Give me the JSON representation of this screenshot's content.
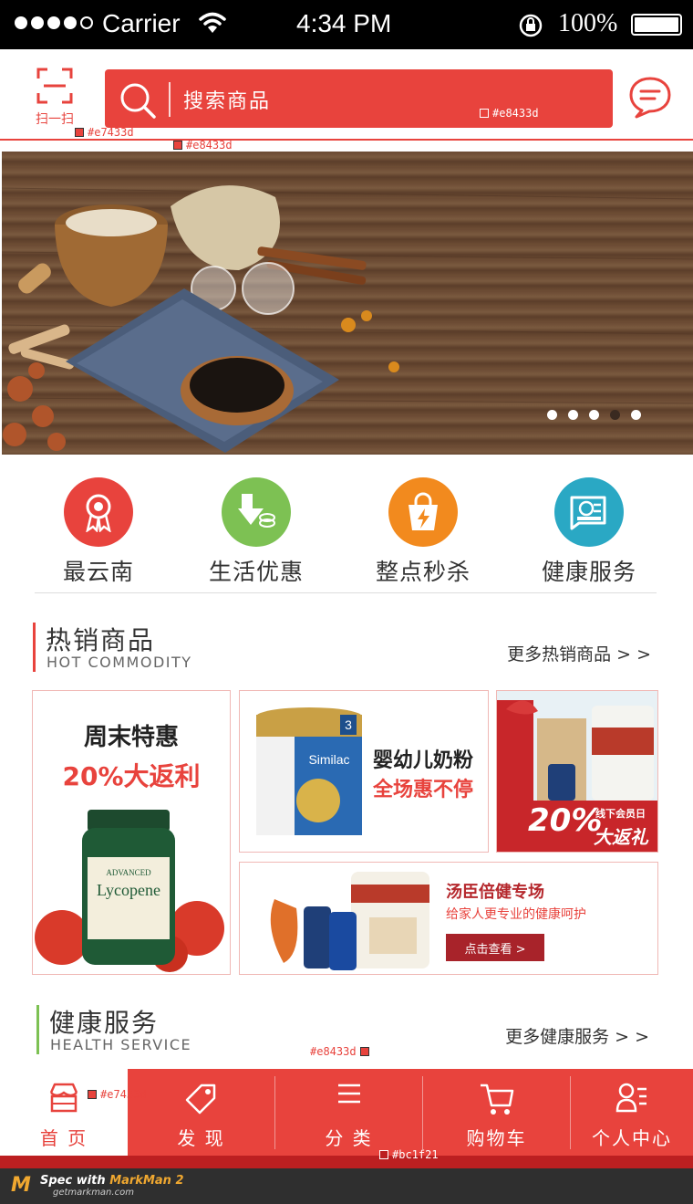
{
  "status_bar": {
    "carrier": "Carrier",
    "time": "4:34 PM",
    "battery": "100%"
  },
  "header": {
    "scan_label": "扫一扫",
    "search_placeholder": "搜索商品"
  },
  "specs": {
    "scan_color": "#e7433d",
    "line_color": "#e8433d",
    "search_color": "#e8433d",
    "tabbar_color": "#e8433d",
    "home_color": "#e7433d",
    "bottom_color": "#bc1f21"
  },
  "banner": {
    "slide_count": 5,
    "active_index": 3
  },
  "categories": [
    {
      "label": "最云南",
      "icon": "ribbon-icon",
      "color": "#e8433d"
    },
    {
      "label": "生活优惠",
      "icon": "coupon-download-icon",
      "color": "#7dc153"
    },
    {
      "label": "整点秒杀",
      "icon": "shopping-bag-flash-icon",
      "color": "#f28a1e"
    },
    {
      "label": "健康服务",
      "icon": "health-card-icon",
      "color": "#2aa8c4"
    }
  ],
  "hot": {
    "title": "热销商品",
    "subtitle": "HOT COMMODITY",
    "more": "更多热销商品 > >",
    "accent": "#e8433d"
  },
  "products": {
    "card1": {
      "line1": "周末特惠",
      "line2": "20%大返利"
    },
    "card2": {
      "line1": "婴幼儿奶粉",
      "line2": "全场惠不停"
    },
    "card3": {
      "big": "20%",
      "small": "线下会员日",
      "tag": "大返礼"
    },
    "card4": {
      "title": "汤臣倍健专场",
      "desc": "给家人更专业的健康呵护",
      "button": "点击查看 >"
    }
  },
  "health": {
    "title": "健康服务",
    "subtitle": "HEALTH SERVICE",
    "more": "更多健康服务 > >",
    "accent": "#7dc153"
  },
  "tabs": [
    {
      "label": "首 页",
      "icon": "store-icon"
    },
    {
      "label": "发 现",
      "icon": "tag-icon"
    },
    {
      "label": "分 类",
      "icon": "list-icon"
    },
    {
      "label": "购物车",
      "icon": "cart-icon"
    },
    {
      "label": "个人中心",
      "icon": "profile-icon"
    }
  ],
  "footer": {
    "spec_prefix": "Spec with",
    "spec_brand": "MarkMan 2",
    "site": "getmarkman.com"
  }
}
